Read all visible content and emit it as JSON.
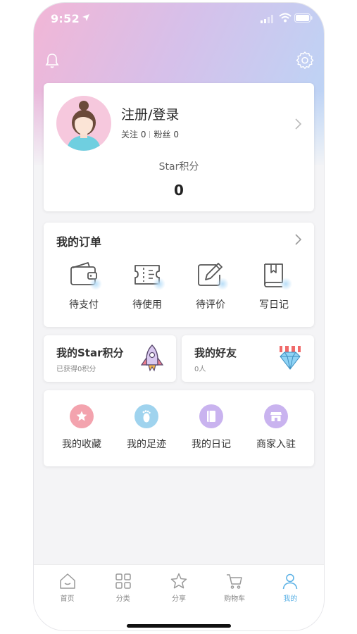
{
  "status_bar": {
    "time": "9:52"
  },
  "profile": {
    "name": "注册/登录",
    "follow_label": "关注",
    "follow_count": "0",
    "fans_label": "粉丝",
    "fans_count": "0",
    "points_label": "Star积分",
    "points_value": "0"
  },
  "orders": {
    "title": "我的订单",
    "items": [
      {
        "label": "待支付",
        "icon": "wallet-icon"
      },
      {
        "label": "待使用",
        "icon": "ticket-icon"
      },
      {
        "label": "待评价",
        "icon": "edit-review-icon"
      },
      {
        "label": "写日记",
        "icon": "diary-book-icon"
      }
    ]
  },
  "mini_cards": {
    "points": {
      "title": "我的Star积分",
      "subtitle": "已获得0积分",
      "icon": "rocket-icon"
    },
    "friends": {
      "title": "我的好友",
      "subtitle": "0人",
      "icon": "diamond-icon"
    }
  },
  "services": [
    {
      "label": "我的收藏",
      "icon": "star-icon",
      "color": "#f3a3ae"
    },
    {
      "label": "我的足迹",
      "icon": "footprint-icon",
      "color": "#9fd3ee"
    },
    {
      "label": "我的日记",
      "icon": "notebook-icon",
      "color": "#c9b3ef"
    },
    {
      "label": "商家入驻",
      "icon": "store-icon",
      "color": "#c9b3ef"
    }
  ],
  "tabbar": {
    "items": [
      {
        "label": "首页",
        "icon": "home-icon"
      },
      {
        "label": "分类",
        "icon": "category-icon"
      },
      {
        "label": "分享",
        "icon": "share-star-icon"
      },
      {
        "label": "购物车",
        "icon": "cart-icon"
      },
      {
        "label": "我的",
        "icon": "profile-icon",
        "active": true
      }
    ]
  },
  "colors": {
    "accent": "#5fb3e6",
    "header_pink": "#f2b6d6",
    "header_blue": "#b9d7f7"
  }
}
